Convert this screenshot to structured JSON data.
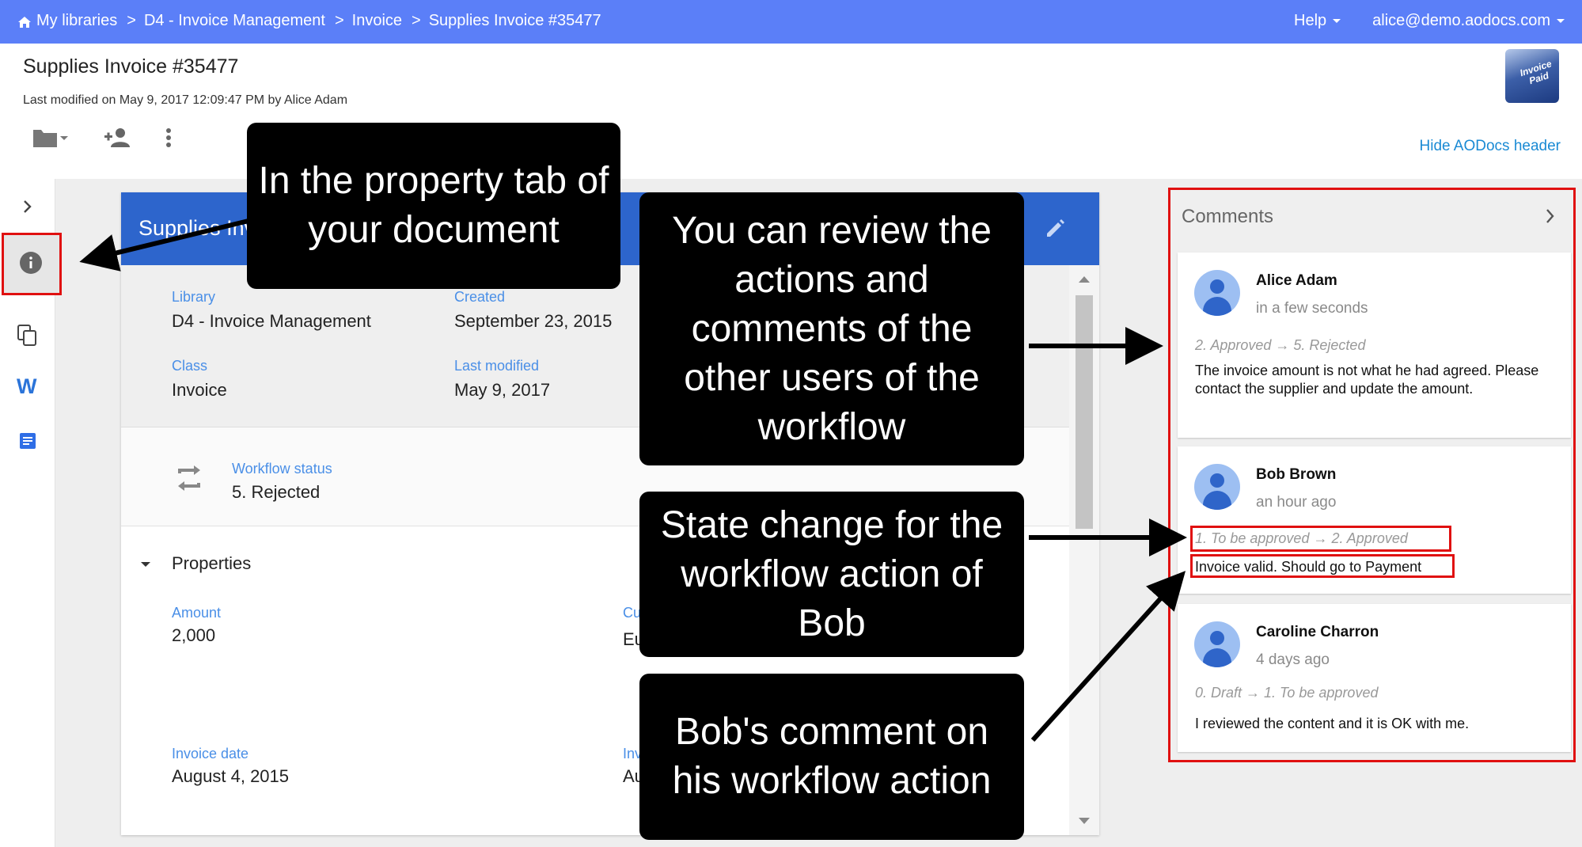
{
  "topbar": {
    "breadcrumbs": [
      "My libraries",
      "D4 - Invoice Management",
      "Invoice",
      "Supplies Invoice #35477"
    ],
    "separator": ">",
    "help_label": "Help",
    "user_label": "alice@demo.aodocs.com",
    "color": "#5b7ff8"
  },
  "document": {
    "title": "Supplies Invoice #35477",
    "last_modified": "Last modified on May 9, 2017 12:09:47 PM by Alice Adam",
    "logo_text": "Invoice Paid",
    "hide_header_label": "Hide AODocs header",
    "toolbar_icons": [
      "folder-icon",
      "add-person-icon",
      "more-vert-icon"
    ]
  },
  "leftbar": {
    "icons": [
      "chevron-right-icon",
      "info-icon",
      "copy-icon",
      "word-icon",
      "docs-icon"
    ]
  },
  "card": {
    "header_title": "Supplies Invoice #35477",
    "header_color": "#2d65cc",
    "fields": {
      "library_label": "Library",
      "library_value": "D4 - Invoice Management",
      "created_label": "Created",
      "created_value": "September 23, 2015",
      "class_label": "Class",
      "class_value": "Invoice",
      "last_modified_label": "Last modified",
      "last_modified_value": "May 9, 2017"
    },
    "workflow": {
      "label": "Workflow status",
      "value": "5. Rejected"
    },
    "properties": {
      "title": "Properties",
      "amount_label": "Amount",
      "amount_value": "2,000",
      "currency_label": "Cu",
      "currency_value": "Eu",
      "invoice_date_label": "Invoice date",
      "invoice_date_value": "August 4, 2015",
      "invoice_other_label": "Inv",
      "invoice_other_value": "Au"
    }
  },
  "comments": {
    "title": "Comments",
    "items": [
      {
        "author": "Alice Adam",
        "time": "in a few seconds",
        "transition": "2. Approved → 5. Rejected",
        "text": "The invoice amount is not what he had agreed. Please contact the supplier and update the amount."
      },
      {
        "author": "Bob Brown",
        "time": "an hour ago",
        "transition": "1. To be approved → 2. Approved",
        "text": "Invoice valid. Should go to Payment"
      },
      {
        "author": "Caroline Charron",
        "time": "4 days ago",
        "transition": "0. Draft → 1. To be approved",
        "text": "I reviewed the content and it is OK with me."
      }
    ]
  },
  "callouts": {
    "property_tab": "In the property tab of your document",
    "review": "You can review the actions and comments of the other users of the workflow",
    "state_change": "State change for the workflow action of Bob",
    "bob_comment": "Bob's comment on his workflow action"
  },
  "colors": {
    "highlight": "#e01010",
    "link": "#1a8ad4",
    "field_label": "#4a8fe7"
  }
}
